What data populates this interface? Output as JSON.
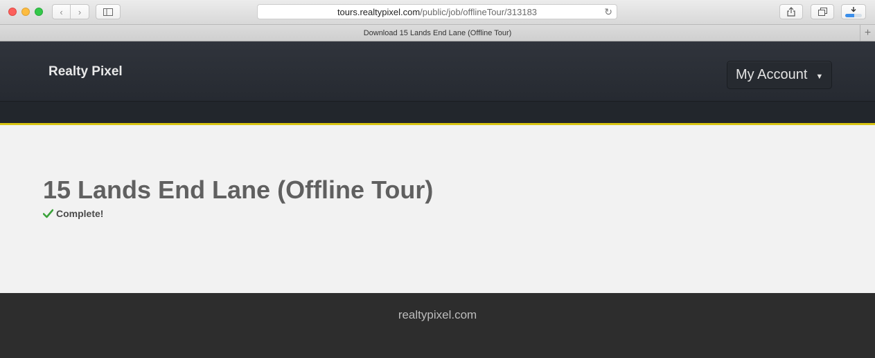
{
  "browser": {
    "url_host": "tours.realtypixel.com",
    "url_path": "/public/job/offlineTour/313183",
    "tab_title": "Download 15 Lands End Lane (Offline Tour)",
    "download_progress": 0.55,
    "icons": [
      "chevron-left-icon",
      "chevron-right-icon",
      "sidebar-icon",
      "reload-icon",
      "share-icon",
      "tabs-icon",
      "download-icon",
      "plus-icon"
    ]
  },
  "header": {
    "brand": "Realty Pixel",
    "account_label": "My Account",
    "caret": "▼"
  },
  "main": {
    "title": "15 Lands End Lane (Offline Tour)",
    "status": "Complete!",
    "status_color": "#3aa23a"
  },
  "footer": {
    "text": "realtypixel.com"
  },
  "colors": {
    "accent": "#d9c512",
    "header_bg": "#2b2f36",
    "footer_bg": "#2d2d2d"
  }
}
